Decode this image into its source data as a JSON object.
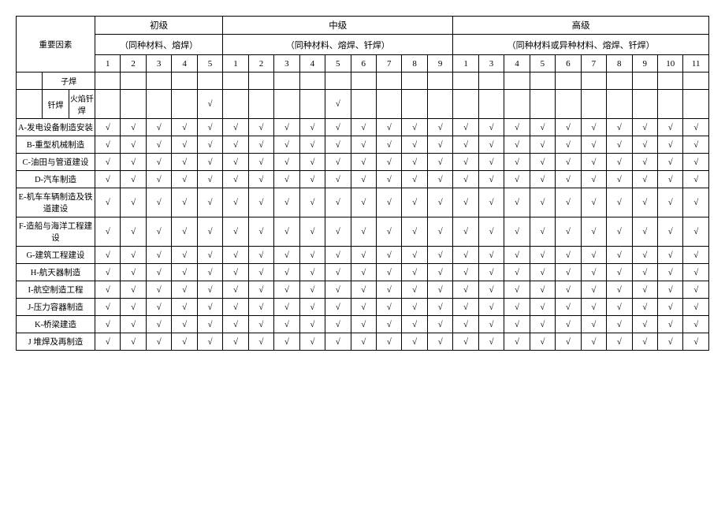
{
  "header": {
    "row_factor": "重要因素",
    "levels": [
      {
        "title": "初级",
        "subtitle": "（同种材料、熔焊）",
        "cols": [
          "1",
          "2",
          "3",
          "4",
          "5"
        ]
      },
      {
        "title": "中级",
        "subtitle": "（同种材料、熔焊、钎焊）",
        "cols": [
          "1",
          "2",
          "3",
          "4",
          "5",
          "6",
          "7",
          "8",
          "9"
        ]
      },
      {
        "title": "高级",
        "subtitle": "（同种材料或异种材料、熔焊、钎焊）",
        "cols": [
          "1",
          "3",
          "4",
          "5",
          "6",
          "7",
          "8",
          "9",
          "10",
          "11"
        ]
      }
    ]
  },
  "sub_rows": {
    "zi": "子焊",
    "qian": "钎焊",
    "huoyan": "火焰钎焊"
  },
  "rows": [
    {
      "label": "A-发电设备制造安装",
      "marks": [
        "√",
        "√",
        "√",
        "√",
        "√",
        "√",
        "√",
        "√",
        "√",
        "√",
        "√",
        "√",
        "√",
        "√",
        "√",
        "√",
        "√",
        "√",
        "√",
        "√",
        "√",
        "√",
        "√",
        "√"
      ]
    },
    {
      "label": "B-重型机械制造",
      "marks": [
        "√",
        "√",
        "√",
        "√",
        "√",
        "√",
        "√",
        "√",
        "√",
        "√",
        "√",
        "√",
        "√",
        "√",
        "√",
        "√",
        "√",
        "√",
        "√",
        "√",
        "√",
        "√",
        "√",
        "√"
      ]
    },
    {
      "label": "C-油田与管道建设",
      "marks": [
        "√",
        "√",
        "√",
        "√",
        "√",
        "√",
        "√",
        "√",
        "√",
        "√",
        "√",
        "√",
        "√",
        "√",
        "√",
        "√",
        "√",
        "√",
        "√",
        "√",
        "√",
        "√",
        "√",
        "√"
      ]
    },
    {
      "label": "D-汽车制造",
      "marks": [
        "√",
        "√",
        "√",
        "√",
        "√",
        "√",
        "√",
        "√",
        "√",
        "√",
        "√",
        "√",
        "√",
        "√",
        "√",
        "√",
        "√",
        "√",
        "√",
        "√",
        "√",
        "√",
        "√",
        "√"
      ]
    },
    {
      "label": "E-机车车辆制造及铁道建设",
      "marks": [
        "√",
        "√",
        "√",
        "√",
        "√",
        "√",
        "√",
        "√",
        "√",
        "√",
        "√",
        "√",
        "√",
        "√",
        "√",
        "√",
        "√",
        "√",
        "√",
        "√",
        "√",
        "√",
        "√",
        "√"
      ]
    },
    {
      "label": "F-造船与海洋工程建设",
      "marks": [
        "√",
        "√",
        "√",
        "√",
        "√",
        "√",
        "√",
        "√",
        "√",
        "√",
        "√",
        "√",
        "√",
        "√",
        "√",
        "√",
        "√",
        "√",
        "√",
        "√",
        "√",
        "√",
        "√",
        "√"
      ]
    },
    {
      "label": "G-建筑工程建设",
      "marks": [
        "√",
        "√",
        "√",
        "√",
        "√",
        "√",
        "√",
        "√",
        "√",
        "√",
        "√",
        "√",
        "√",
        "√",
        "√",
        "√",
        "√",
        "√",
        "√",
        "√",
        "√",
        "√",
        "√",
        "√"
      ]
    },
    {
      "label": "H-航天器制造",
      "marks": [
        "√",
        "√",
        "√",
        "√",
        "√",
        "√",
        "√",
        "√",
        "√",
        "√",
        "√",
        "√",
        "√",
        "√",
        "√",
        "√",
        "√",
        "√",
        "√",
        "√",
        "√",
        "√",
        "√",
        "√"
      ]
    },
    {
      "label": "I-航空制造工程",
      "marks": [
        "√",
        "√",
        "√",
        "√",
        "√",
        "√",
        "√",
        "√",
        "√",
        "√",
        "√",
        "√",
        "√",
        "√",
        "√",
        "√",
        "√",
        "√",
        "√",
        "√",
        "√",
        "√",
        "√",
        "√"
      ]
    },
    {
      "label": "J-压力容器制造",
      "marks": [
        "√",
        "√",
        "√",
        "√",
        "√",
        "√",
        "√",
        "√",
        "√",
        "√",
        "√",
        "√",
        "√",
        "√",
        "√",
        "√",
        "√",
        "√",
        "√",
        "√",
        "√",
        "√",
        "√",
        "√"
      ]
    },
    {
      "label": "K-桥梁建造",
      "marks": [
        "√",
        "√",
        "√",
        "√",
        "√",
        "√",
        "√",
        "√",
        "√",
        "√",
        "√",
        "√",
        "√",
        "√",
        "√",
        "√",
        "√",
        "√",
        "√",
        "√",
        "√",
        "√",
        "√",
        "√"
      ]
    },
    {
      "label": "J 堆焊及再制造",
      "marks": [
        "√",
        "√",
        "√",
        "√",
        "√",
        "√",
        "√",
        "√",
        "√",
        "√",
        "√",
        "√",
        "√",
        "√",
        "√",
        "√",
        "√",
        "√",
        "√",
        "√",
        "√",
        "√",
        "√",
        "√"
      ]
    }
  ],
  "qian_row_marks": [
    "",
    "",
    "",
    "",
    "√",
    "",
    "",
    "",
    "",
    "√",
    "",
    "",
    "",
    "",
    "",
    "",
    "",
    "",
    "",
    "",
    "",
    "",
    "",
    ""
  ]
}
